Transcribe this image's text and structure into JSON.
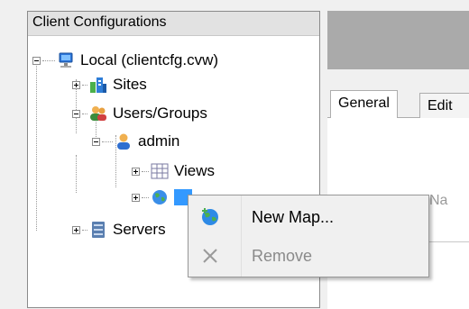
{
  "tree": {
    "header": "Client Configurations",
    "nodes": {
      "local": "Local (clientcfg.cvw)",
      "sites": "Sites",
      "users_groups": "Users/Groups",
      "admin": "admin",
      "views": "Views",
      "servers": "Servers"
    }
  },
  "tabs": {
    "general": "General",
    "edit": "Edit"
  },
  "background_text": "Na",
  "context_menu": {
    "items": [
      {
        "label": "New Map...",
        "enabled": true,
        "icon": "globe-plus-icon"
      },
      {
        "label": "Remove",
        "enabled": false,
        "icon": "x-icon"
      }
    ]
  },
  "colors": {
    "panel_border": "#8a8a8a",
    "header_bg": "#e2e2e2",
    "right_dark": "#aaaaaa",
    "disabled_text": "#8a8a8a"
  }
}
